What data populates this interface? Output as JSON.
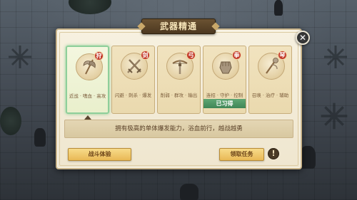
{
  "dialog": {
    "title": "武器精通",
    "close_label": "✕",
    "description": "拥有极高的单体爆发能力，浴血前行，越战越勇"
  },
  "weapons": [
    {
      "badge": "狩",
      "desc": "近战 · 嗜血 · 高攻",
      "learned": "",
      "selected": true,
      "icon": "axe-icon"
    },
    {
      "badge": "剑",
      "desc": "闪避 · 刺杀 · 爆发",
      "learned": "",
      "selected": false,
      "icon": "dual-swords-icon"
    },
    {
      "badge": "弓",
      "desc": "削弱 · 群攻 · 输出",
      "learned": "",
      "selected": false,
      "icon": "crossbow-icon"
    },
    {
      "badge": "拳",
      "desc": "连招 · 守护 · 控制",
      "learned": "已习得",
      "selected": false,
      "icon": "gauntlet-icon"
    },
    {
      "badge": "琴",
      "desc": "召唤 · 治疗 · 辅助",
      "learned": "",
      "selected": false,
      "icon": "staff-icon"
    }
  ],
  "buttons": {
    "trial_label": "战斗体验",
    "quest_label": "领取任务",
    "info_label": "!"
  },
  "colors": {
    "selected_border": "#8ecf9a",
    "learned_tag": "#4f975f",
    "badge": "#c23a2a",
    "button": "#efc86e"
  }
}
